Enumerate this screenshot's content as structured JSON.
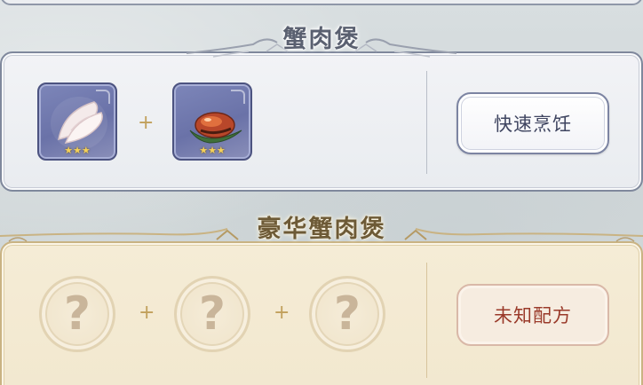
{
  "recipes": [
    {
      "title": "蟹肉煲",
      "ingredients": [
        {
          "icon": "white-fish-fillet-icon",
          "stars": "★★★"
        },
        {
          "icon": "glazed-meat-on-leaf-icon",
          "stars": "★★★"
        }
      ],
      "plus": "+",
      "action_label": "快速烹饪"
    },
    {
      "title": "豪华蟹肉煲",
      "unknown_slots": [
        "?",
        "?",
        "?"
      ],
      "plus": "+",
      "action_label": "未知配方"
    }
  ],
  "colors": {
    "known_border": "#7f889c",
    "unknown_border": "#c9b383",
    "item_bg": "#737cb2",
    "star": "#f4d15a",
    "unknown_text": "#9a3a2a"
  }
}
